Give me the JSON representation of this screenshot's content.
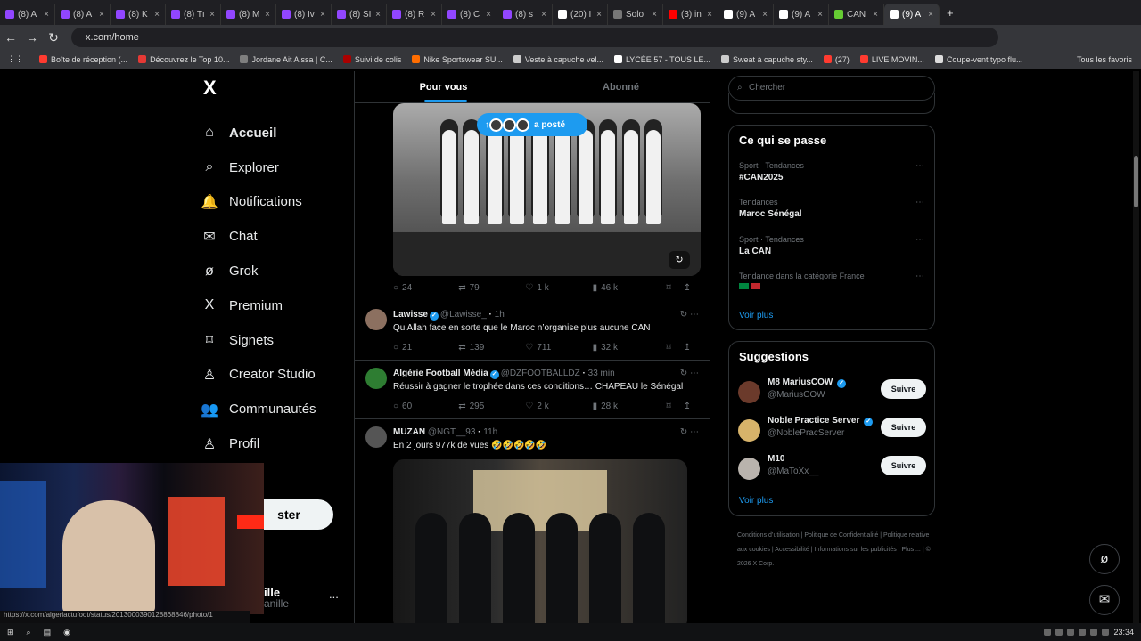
{
  "browser": {
    "tabs": [
      {
        "label": "(8) A",
        "color": "#9146ff"
      },
      {
        "label": "(8) A",
        "color": "#9146ff"
      },
      {
        "label": "(8) K",
        "color": "#9146ff"
      },
      {
        "label": "(8) Tı",
        "color": "#9146ff"
      },
      {
        "label": "(8) M",
        "color": "#9146ff"
      },
      {
        "label": "(8) Iv",
        "color": "#9146ff"
      },
      {
        "label": "(8) SI",
        "color": "#9146ff"
      },
      {
        "label": "(8) R",
        "color": "#9146ff"
      },
      {
        "label": "(8) C",
        "color": "#9146ff"
      },
      {
        "label": "(8) s",
        "color": "#9146ff"
      },
      {
        "label": "(20) I",
        "color": "#ffffff"
      },
      {
        "label": "Solo",
        "color": "#777777"
      },
      {
        "label": "(3) in",
        "color": "#ff0000"
      },
      {
        "label": "(9) A",
        "color": "#ffffff"
      },
      {
        "label": "(9) A",
        "color": "#ffffff"
      },
      {
        "label": "CAN",
        "color": "#6c3"
      },
      {
        "label": "(9) A",
        "color": "#ffffff",
        "active": true
      }
    ],
    "url": "x.com/home",
    "bookmarks": [
      "Boîte de réception (...",
      "Découvrez le Top 10...",
      "Jordane Ait Aissa | C...",
      "Suivi de colis",
      "Nike Sportswear SU...",
      "Veste à capuche vel...",
      "LYCÉE 57 - TOUS LE...",
      "Sweat à capuche sty...",
      "(27)",
      "LIVE MOVIN...",
      "Coupe-vent typo flu..."
    ],
    "all_bookmarks": "Tous les favoris",
    "status_url": "https://x.com/algeriactufoot/status/2013000390128868846/photo/1"
  },
  "left_nav": {
    "logo": "X",
    "items": [
      "Accueil",
      "Explorer",
      "Notifications",
      "Chat",
      "Grok",
      "Premium",
      "Signets",
      "Creator Studio",
      "Communautés",
      "Profil"
    ],
    "post_button": "ster",
    "profile_name": "ille",
    "profile_handle": "anille",
    "more": "..."
  },
  "feed": {
    "tabs": [
      "Pour vous",
      "Abonné"
    ],
    "posted_pill": "a posté",
    "tweet1_stats": {
      "reply": "24",
      "retweet": "79",
      "like": "1 k",
      "views": "46 k"
    },
    "tweets": [
      {
        "name": "Lawisse",
        "handle": "@Lawisse_",
        "time": "1h",
        "text": "Qu’Allah face en sorte que le Maroc n’organise plus aucune CAN",
        "reply": "21",
        "retweet": "139",
        "like": "711",
        "views": "32 k"
      },
      {
        "name": "Algérie Football Média",
        "handle": "@DZFOOTBALLDZ",
        "time": "33 min",
        "text": "Réussir à gagner le trophée dans ces conditions… CHAPEAU le Sénégal",
        "reply": "60",
        "retweet": "295",
        "like": "2 k",
        "views": "28 k"
      },
      {
        "name": "MUZAN",
        "handle": "@NGT__93",
        "time": "11h",
        "text": "En 2 jours 977k de vues 🤣🤣🤣🤣🤣"
      }
    ]
  },
  "right_column": {
    "search_placeholder": "Chercher",
    "trends_title": "Ce qui se passe",
    "trends": [
      {
        "category": "Sport · Tendances",
        "name": "#CAN2025"
      },
      {
        "category": "Tendances",
        "name": "Maroc Sénégal"
      },
      {
        "category": "Sport · Tendances",
        "name": "La CAN"
      },
      {
        "category": "Tendance dans la catégorie France",
        "name": ""
      }
    ],
    "trends_more": "Voir plus",
    "suggestions_title": "Suggestions",
    "suggestions": [
      {
        "name": "M8 MariusCOW",
        "handle": "@MariusCOW",
        "button": "Suivre"
      },
      {
        "name": "Noble Practice Server",
        "handle": "@NoblePracServer",
        "button": "Suivre"
      },
      {
        "name": "M10",
        "handle": "@MaToXx__",
        "button": "Suivre"
      }
    ],
    "suggestions_more": "Voir plus",
    "footer": [
      "Conditions d’utilisation",
      "Politique de Confidentialité",
      "Politique relative aux cookies",
      "Accessibilité",
      "Informations sur les publicités",
      "Plus ...",
      "© 2026 X Corp."
    ]
  },
  "taskbar": {
    "time": "23:34"
  }
}
